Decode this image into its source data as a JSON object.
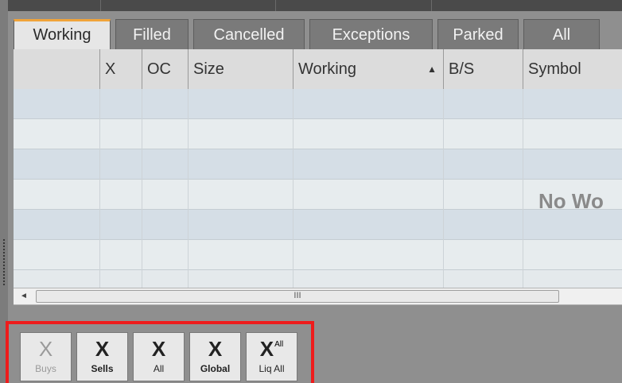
{
  "tabs": [
    {
      "label": "Working",
      "active": true
    },
    {
      "label": "Filled"
    },
    {
      "label": "Cancelled"
    },
    {
      "label": "Exceptions"
    },
    {
      "label": "Parked"
    },
    {
      "label": "All"
    }
  ],
  "grid": {
    "columns": [
      "",
      "X",
      "OC",
      "Size",
      "Working",
      "B/S",
      "Symbol"
    ],
    "sorted_column": "Working",
    "sort_direction": "ascending",
    "empty_message": "No Wo"
  },
  "scrollbar": {
    "left_arrow": "◄",
    "thumb_grip": "III"
  },
  "actions": {
    "buys": {
      "icon": "X",
      "label": "Buys"
    },
    "sells": {
      "icon": "X",
      "label": "Sells"
    },
    "all": {
      "icon": "X",
      "label": "All"
    },
    "global": {
      "icon": "X",
      "label": "Global"
    },
    "liq_all": {
      "icon": "X",
      "superscript": "All",
      "label": "Liq All"
    }
  },
  "colors": {
    "active_tab_accent": "#f0a43a",
    "highlight_border": "#ee1c1c",
    "row_alt": "#d5dee6"
  }
}
